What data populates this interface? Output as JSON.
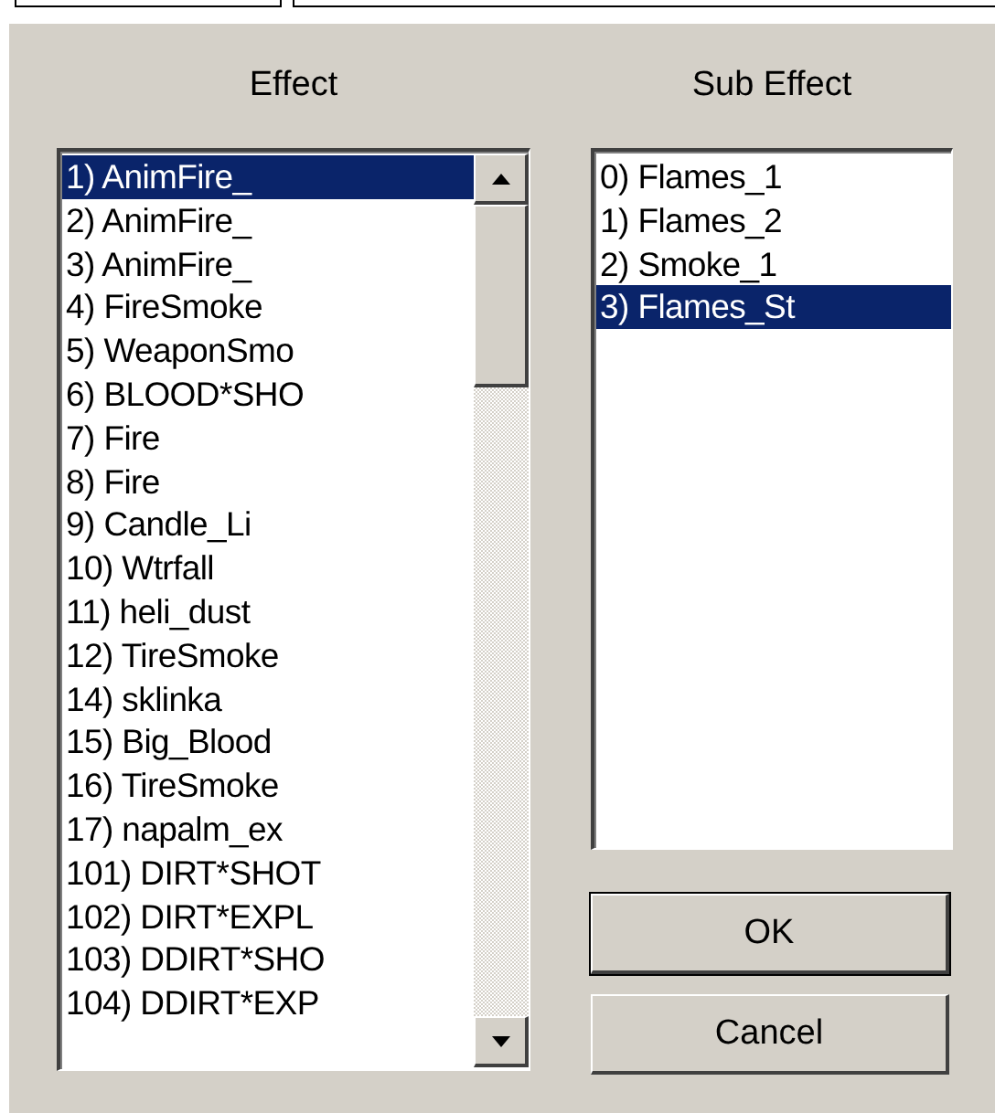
{
  "effect_list": {
    "label": "Effect",
    "items": [
      {
        "text": "1) AnimFire_",
        "selected": true
      },
      {
        "text": "2) AnimFire_",
        "selected": false
      },
      {
        "text": "3) AnimFire_",
        "selected": false
      },
      {
        "text": "4) FireSmoke",
        "selected": false
      },
      {
        "text": "5) WeaponSmo",
        "selected": false
      },
      {
        "text": "6) BLOOD*SHO",
        "selected": false
      },
      {
        "text": "7) Fire",
        "selected": false
      },
      {
        "text": "8) Fire",
        "selected": false
      },
      {
        "text": "9) Candle_Li",
        "selected": false
      },
      {
        "text": "10) Wtrfall",
        "selected": false
      },
      {
        "text": "11) heli_dust",
        "selected": false
      },
      {
        "text": "12) TireSmoke",
        "selected": false
      },
      {
        "text": "14) sklinka",
        "selected": false
      },
      {
        "text": "15) Big_Blood",
        "selected": false
      },
      {
        "text": "16) TireSmoke",
        "selected": false
      },
      {
        "text": "17) napalm_ex",
        "selected": false
      },
      {
        "text": "101) DIRT*SHOT",
        "selected": false
      },
      {
        "text": "102) DIRT*EXPL",
        "selected": false
      },
      {
        "text": "103) DDIRT*SHO",
        "selected": false
      },
      {
        "text": "104) DDIRT*EXP",
        "selected": false
      }
    ]
  },
  "sub_effect_list": {
    "label": "Sub Effect",
    "items": [
      {
        "text": "0) Flames_1",
        "selected": false
      },
      {
        "text": "1) Flames_2",
        "selected": false
      },
      {
        "text": "2) Smoke_1",
        "selected": false
      },
      {
        "text": "3) Flames_St",
        "selected": true
      }
    ]
  },
  "buttons": [
    {
      "label": "OK",
      "default": true
    },
    {
      "label": "Cancel",
      "default": false
    }
  ]
}
